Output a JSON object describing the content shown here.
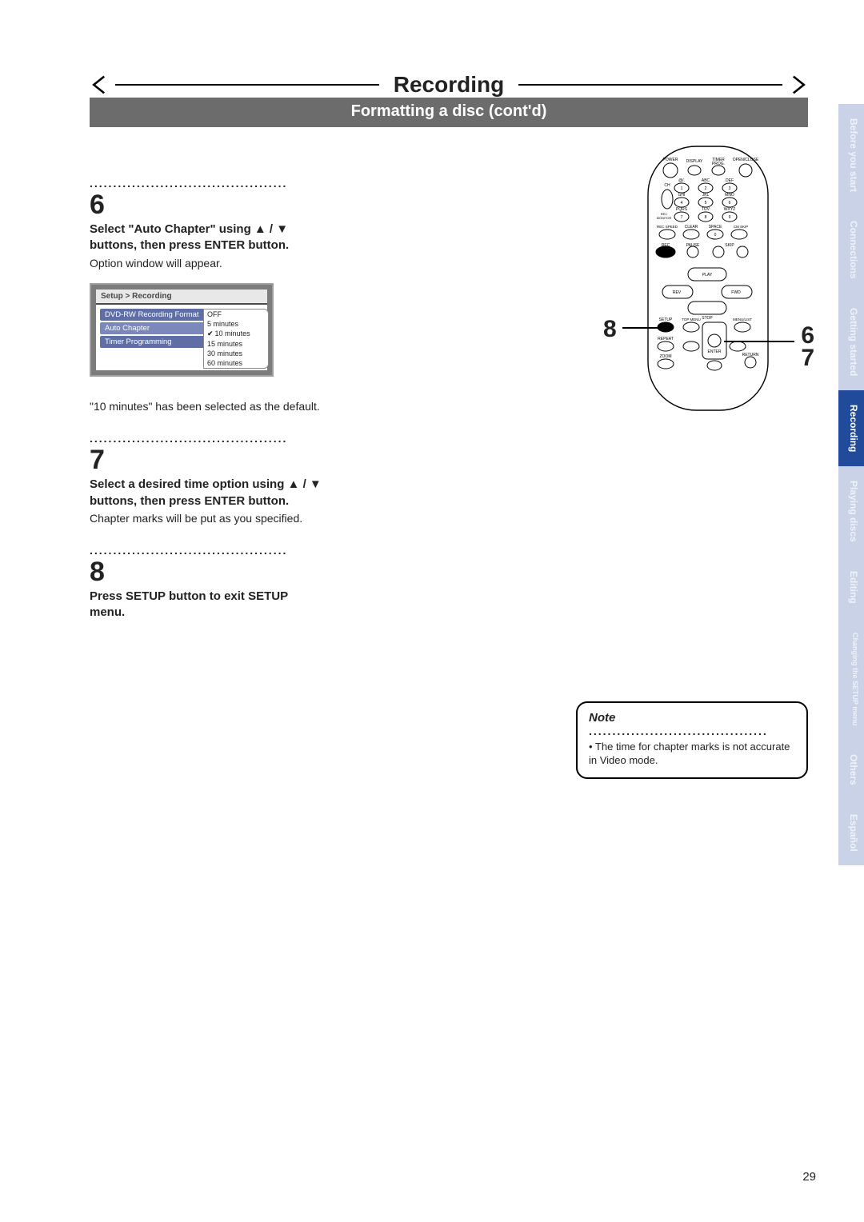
{
  "page_number": "29",
  "title": "Recording",
  "subtitle": "Formatting a disc (cont'd)",
  "tabs": [
    {
      "label": "Before you start",
      "active": false
    },
    {
      "label": "Connections",
      "active": false
    },
    {
      "label": "Getting started",
      "active": false
    },
    {
      "label": "Recording",
      "active": true
    },
    {
      "label": "Playing discs",
      "active": false
    },
    {
      "label": "Editing",
      "active": false
    },
    {
      "label": "Changing the SETUP menu",
      "active": false
    },
    {
      "label": "Others",
      "active": false
    },
    {
      "label": "Español",
      "active": false
    }
  ],
  "steps": [
    {
      "num": "6",
      "bold": "Select \"Auto Chapter\" using ▲ / ▼ buttons, then press ENTER button.",
      "text": "Option window will appear.",
      "after_text": "\"10 minutes\" has been selected as the default."
    },
    {
      "num": "7",
      "bold": "Select a desired time option using ▲ / ▼ buttons, then press ENTER button.",
      "text": "Chapter marks will be put as you specified."
    },
    {
      "num": "8",
      "bold": "Press SETUP button to exit SETUP menu.",
      "text": ""
    }
  ],
  "menu": {
    "breadcrumb": "Setup > Recording",
    "rows": [
      {
        "label": "DVD-RW Recording Format",
        "sel": false
      },
      {
        "label": "Auto Chapter",
        "sel": true
      },
      {
        "label": "Timer Programming",
        "sel": false
      }
    ],
    "options": [
      {
        "label": "OFF",
        "sel": false
      },
      {
        "label": "5 minutes",
        "sel": false
      },
      {
        "label": "10 minutes",
        "sel": true
      },
      {
        "label": "15 minutes",
        "sel": false
      },
      {
        "label": "30 minutes",
        "sel": false
      },
      {
        "label": "60 minutes",
        "sel": false
      }
    ]
  },
  "callouts": [
    {
      "num": "8",
      "side": "left"
    },
    {
      "num": "6",
      "side": "right"
    },
    {
      "num": "7",
      "side": "right"
    }
  ],
  "remote": {
    "labels": [
      "POWER",
      "DISPLAY",
      "TIMER PROG.",
      "OPEN/CLOSE",
      "@/.",
      "ABC",
      "DEF",
      "CH",
      "GHI",
      "JKL",
      "MNO",
      "REC MONITOR",
      "PQRS",
      "TUV",
      "WXYZ",
      "REC SPEED",
      "CLEAR",
      "SPACE",
      "CM SKIP",
      "REC",
      "PAUSE",
      "SKIP",
      "PLAY",
      "REV",
      "FWD",
      "STOP",
      "SETUP",
      "TOP MENU",
      "MENU/LIST",
      "REPEAT",
      "ENTER",
      "RETURN",
      "ZOOM"
    ]
  },
  "note": {
    "title": "Note",
    "text": "• The time for chapter marks is not accurate in Video mode."
  }
}
